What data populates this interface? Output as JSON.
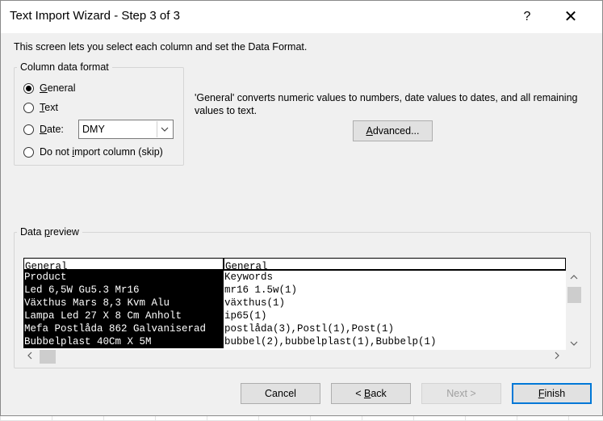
{
  "window": {
    "title": "Text Import Wizard - Step 3 of 3",
    "help": "?",
    "close": "✕"
  },
  "intro": "This screen lets you select each column and set the Data Format.",
  "column_format": {
    "legend": "Column data format",
    "options": [
      {
        "label": "General",
        "checked": true
      },
      {
        "label": "Text",
        "checked": false
      },
      {
        "label": "Date:",
        "checked": false
      },
      {
        "label": "Do not import column (skip)",
        "checked": false
      }
    ],
    "date_format": "DMY"
  },
  "description": "'General' converts numeric values to numbers, date values to dates, and all remaining values to text.",
  "advanced_button": "Advanced...",
  "preview": {
    "legend": "Data preview",
    "columns": [
      {
        "header": "General",
        "cells": [
          "Product",
          "Led 6,5W Gu5.3 Mr16",
          "Växthus Mars 8,3 Kvm Alu",
          "Lampa Led 27 X 8 Cm Anholt",
          "Mefa Postlåda 862 Galvaniserad",
          "Bubbelplast 40Cm X 5M"
        ]
      },
      {
        "header": "General",
        "cells": [
          "Keywords",
          "mr16 1.5w(1)",
          "växthus(1)",
          "ip65(1)",
          "postlåda(3),Postl(1),Post(1)",
          "bubbel(2),bubbelplast(1),Bubbelp(1)"
        ]
      }
    ]
  },
  "buttons": {
    "cancel": "Cancel",
    "back": "< Back",
    "next": "Next >",
    "finish": "Finish"
  }
}
